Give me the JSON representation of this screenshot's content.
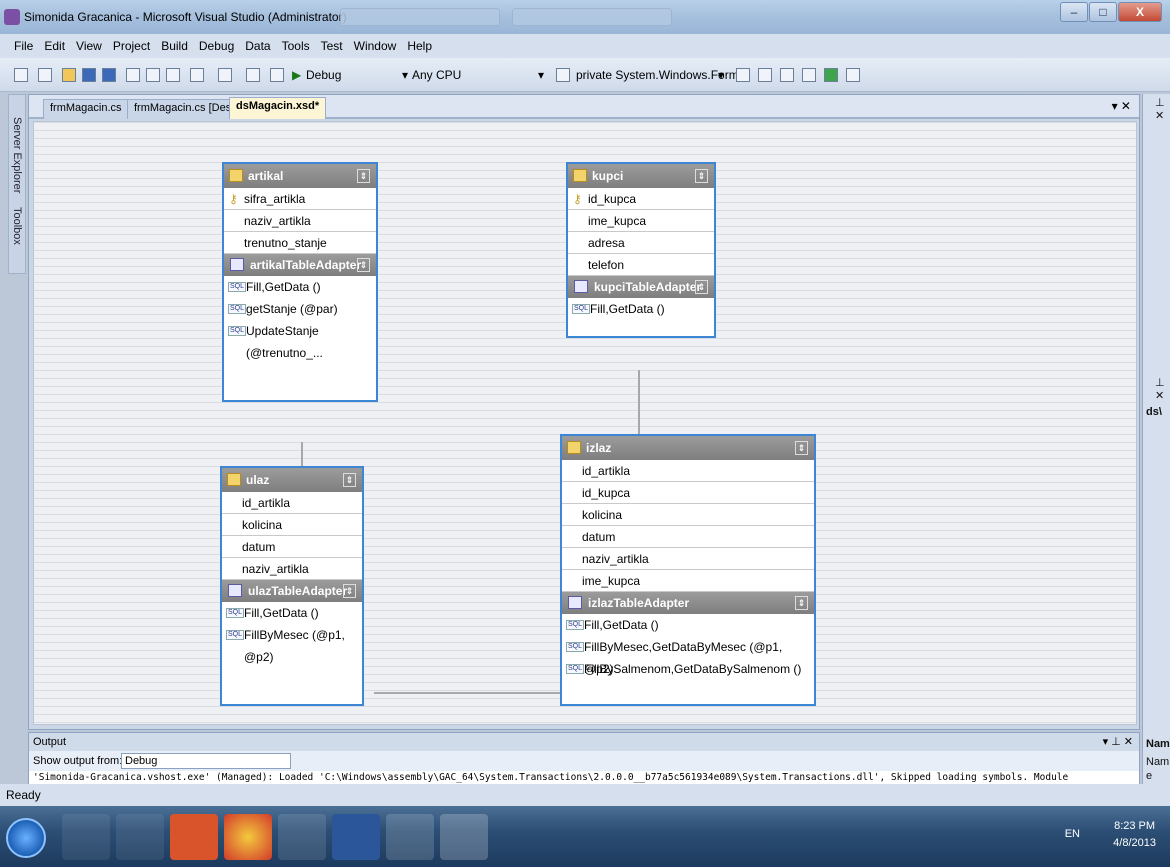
{
  "window": {
    "title": "Simonida Gracanica - Microsoft Visual Studio (Administrator)"
  },
  "menu": [
    "File",
    "Edit",
    "View",
    "Project",
    "Build",
    "Debug",
    "Data",
    "Tools",
    "Test",
    "Window",
    "Help"
  ],
  "toolbar": {
    "config": "Debug",
    "platform": "Any CPU",
    "member": "private System.Windows.Forms"
  },
  "left_strip": {
    "server_explorer": "Server Explorer",
    "toolbox": "Toolbox"
  },
  "tabs": [
    "frmMagacin.cs",
    "frmMagacin.cs [Design]",
    "dsMagacin.xsd*"
  ],
  "tables": {
    "artikal": {
      "name": "artikal",
      "columns": [
        "sifra_artikla",
        "naziv_artikla",
        "trenutno_stanje"
      ],
      "adapter": "artikalTableAdapter",
      "queries": [
        "Fill,GetData ()",
        "getStanje (@par)",
        "UpdateStanje (@trenutno_..."
      ]
    },
    "kupci": {
      "name": "kupci",
      "columns": [
        "id_kupca",
        "ime_kupca",
        "adresa",
        "telefon"
      ],
      "adapter": "kupciTableAdapter",
      "queries": [
        "Fill,GetData ()"
      ]
    },
    "ulaz": {
      "name": "ulaz",
      "columns": [
        "id_artikla",
        "kolicina",
        "datum",
        "naziv_artikla"
      ],
      "adapter": "ulazTableAdapter",
      "queries": [
        "Fill,GetData ()",
        "FillByMesec (@p1, @p2)"
      ]
    },
    "izlaz": {
      "name": "izlaz",
      "columns": [
        "id_artikla",
        "id_kupca",
        "kolicina",
        "datum",
        "naziv_artikla",
        "ime_kupca"
      ],
      "adapter": "izlazTableAdapter",
      "queries": [
        "Fill,GetData ()",
        "FillByMesec,GetDataByMesec (@p1, @p2)",
        "FillBySalmenom,GetDataBySalmenom ()"
      ]
    }
  },
  "output": {
    "title": "Output",
    "show_from_label": "Show output from:",
    "show_from_value": "Debug",
    "line": "'Simonida-Gracanica.vshost.exe' (Managed): Loaded 'C:\\Windows\\assembly\\GAC_64\\System.Transactions\\2.0.0.0__b77a5c561934e089\\System.Transactions.dll', Skipped loading symbols. Module"
  },
  "status": "Ready",
  "right_panel": {
    "ds_label": "ds\\",
    "nam1": "Nam",
    "nam2": "Nam",
    "eo": "e o..."
  },
  "taskbar": {
    "lang": "EN",
    "time": "8:23 PM",
    "date": "4/8/2013"
  }
}
